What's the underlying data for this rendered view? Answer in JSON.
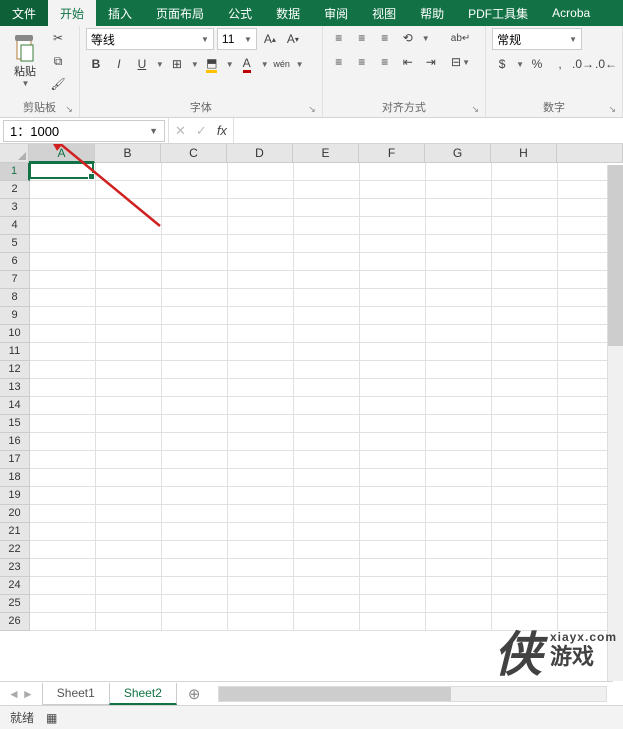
{
  "tabs": {
    "file": "文件",
    "home": "开始",
    "insert": "插入",
    "layout": "页面布局",
    "formulas": "公式",
    "data": "数据",
    "review": "审阅",
    "view": "视图",
    "help": "帮助",
    "pdf": "PDF工具集",
    "acrobat": "Acroba"
  },
  "ribbon": {
    "clipboard": {
      "label": "剪贴板",
      "paste": "粘贴"
    },
    "font": {
      "label": "字体",
      "name": "等线",
      "size": "11",
      "bold": "B",
      "italic": "I",
      "underline": "U",
      "pinyin": "wén"
    },
    "align": {
      "label": "对齐方式",
      "wrap_icon": "ab"
    },
    "number": {
      "label": "数字",
      "format": "常规"
    }
  },
  "fxbar": {
    "namebox": "1：1000",
    "fx": "fx",
    "formula": ""
  },
  "grid": {
    "cols": [
      "A",
      "B",
      "C",
      "D",
      "E",
      "F",
      "G",
      "H"
    ],
    "visible_rows": 26,
    "active": {
      "row": 1,
      "col": "A"
    }
  },
  "sheets": {
    "items": [
      "Sheet1",
      "Sheet2"
    ],
    "active": "Sheet2",
    "add": "+"
  },
  "status": {
    "ready": "就绪"
  },
  "watermark": {
    "logo": "侠",
    "url": "xiayx.com",
    "cn": "游戏"
  }
}
